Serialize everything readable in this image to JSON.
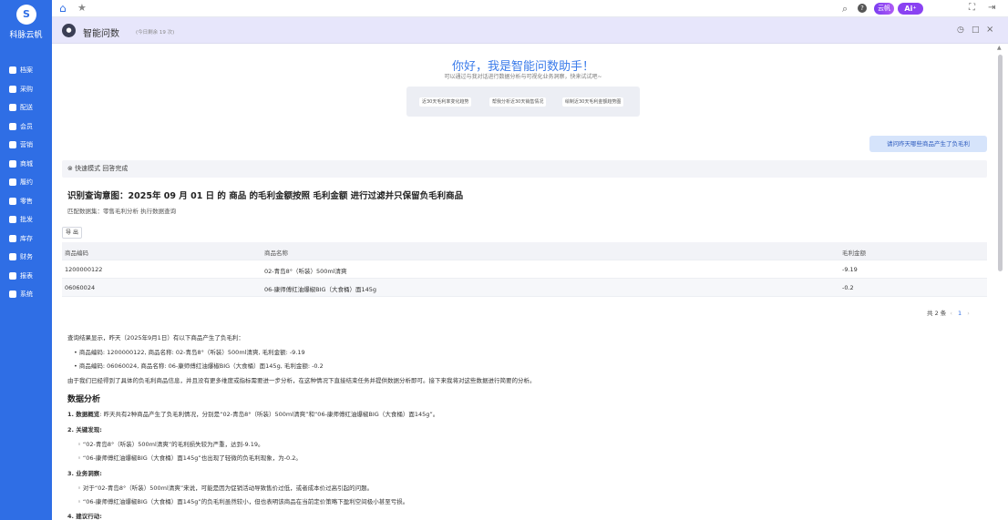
{
  "sidebar": {
    "logo": "S",
    "brand": "科脉云帆",
    "items": [
      {
        "label": "档案"
      },
      {
        "label": "采购"
      },
      {
        "label": "配送"
      },
      {
        "label": "会员"
      },
      {
        "label": "营销"
      },
      {
        "label": "商城"
      },
      {
        "label": "履约"
      },
      {
        "label": "零售"
      },
      {
        "label": "批发"
      },
      {
        "label": "库存"
      },
      {
        "label": "财务"
      },
      {
        "label": "报表"
      },
      {
        "label": "系统"
      }
    ]
  },
  "topbar": {
    "yunfan_label": "云帆",
    "ai_label": "Ai⁺"
  },
  "chat_header": {
    "title": "智能问数",
    "quota": "(今日剩余 19 次)"
  },
  "greeting": {
    "title": "你好，我是智能问数助手！",
    "subtitle": "可以通过与我对话进行数据分析与可视化业务洞察，快来试试吧~",
    "suggestions": [
      "近30天毛利率变化趋势",
      "帮我分析近30天销售情况",
      "绘制近30天毛利金额趋势图"
    ]
  },
  "user_message": "请问昨天哪些商品产生了负毛利",
  "status": "⊗ 快速模式 回答完成",
  "intent": "识别查询意图：2025年 09 月 01 日 的 商品 的毛利金额按照 毛利金额 进行过滤并只保留负毛利商品",
  "dataset": "匹配数据集：零售毛利分析 执行数据查询",
  "export_label": "导 出",
  "table": {
    "columns": [
      "商品编码",
      "商品名称",
      "毛利金额"
    ],
    "rows": [
      [
        "1200000122",
        "02-青岛8°（听装）500ml清爽",
        "-9.19"
      ],
      [
        "06060024",
        "06-康师傅红油爆椒BIG（大食桶）面145g",
        "-0.2"
      ]
    ]
  },
  "pager": {
    "total": "共 2 条",
    "page": "1"
  },
  "answer": {
    "intro": "查询结果显示，昨天（2025年9月1日）有以下商品产生了负毛利：",
    "bullets": [
      "商品编码: 1200000122, 商品名称: 02-青岛8°（听装）500ml清爽, 毛利金额: -9.19",
      "商品编码: 06060024, 商品名称: 06-康师傅红油爆椒BIG（大食桶）面145g, 毛利金额: -0.2"
    ],
    "para": "由于我们已经得到了具体的负毛利商品信息，并且没有更多维度或指标需要进一步分析，在这种情况下直接结束任务并提供数据分析即可。接下来我将对这些数据进行简要的分析。",
    "analysis_title": "数据分析",
    "s1_label": "1. 数据概览",
    "s1_text": ": 昨天共有2种商品产生了负毛利情况，分别是“02-青岛8°（听装）500ml清爽”和“06-康师傅红油爆椒BIG（大食桶）面145g”。",
    "s2_label": "2. 关键发现:",
    "s2_items": [
      "“02-青岛8°（听装）500ml清爽”的毛利损失较为严重，达到-9.19。",
      "“06-康师傅红油爆椒BIG（大食桶）面145g”也出现了轻微的负毛利现象，为-0.2。"
    ],
    "s3_label": "3. 业务洞察:",
    "s3_items": [
      "对于“02-青岛8°（听装）500ml清爽”来说，可能是因为促销活动导致售价过低，或者成本价过高引起的问题。",
      "“06-康师傅红油爆椒BIG（大食桶）面145g”的负毛利虽然较小，但也表明该商品在当前定价策略下盈利空间极小甚至亏损。"
    ],
    "s4_label": "4. 建议行动:"
  }
}
